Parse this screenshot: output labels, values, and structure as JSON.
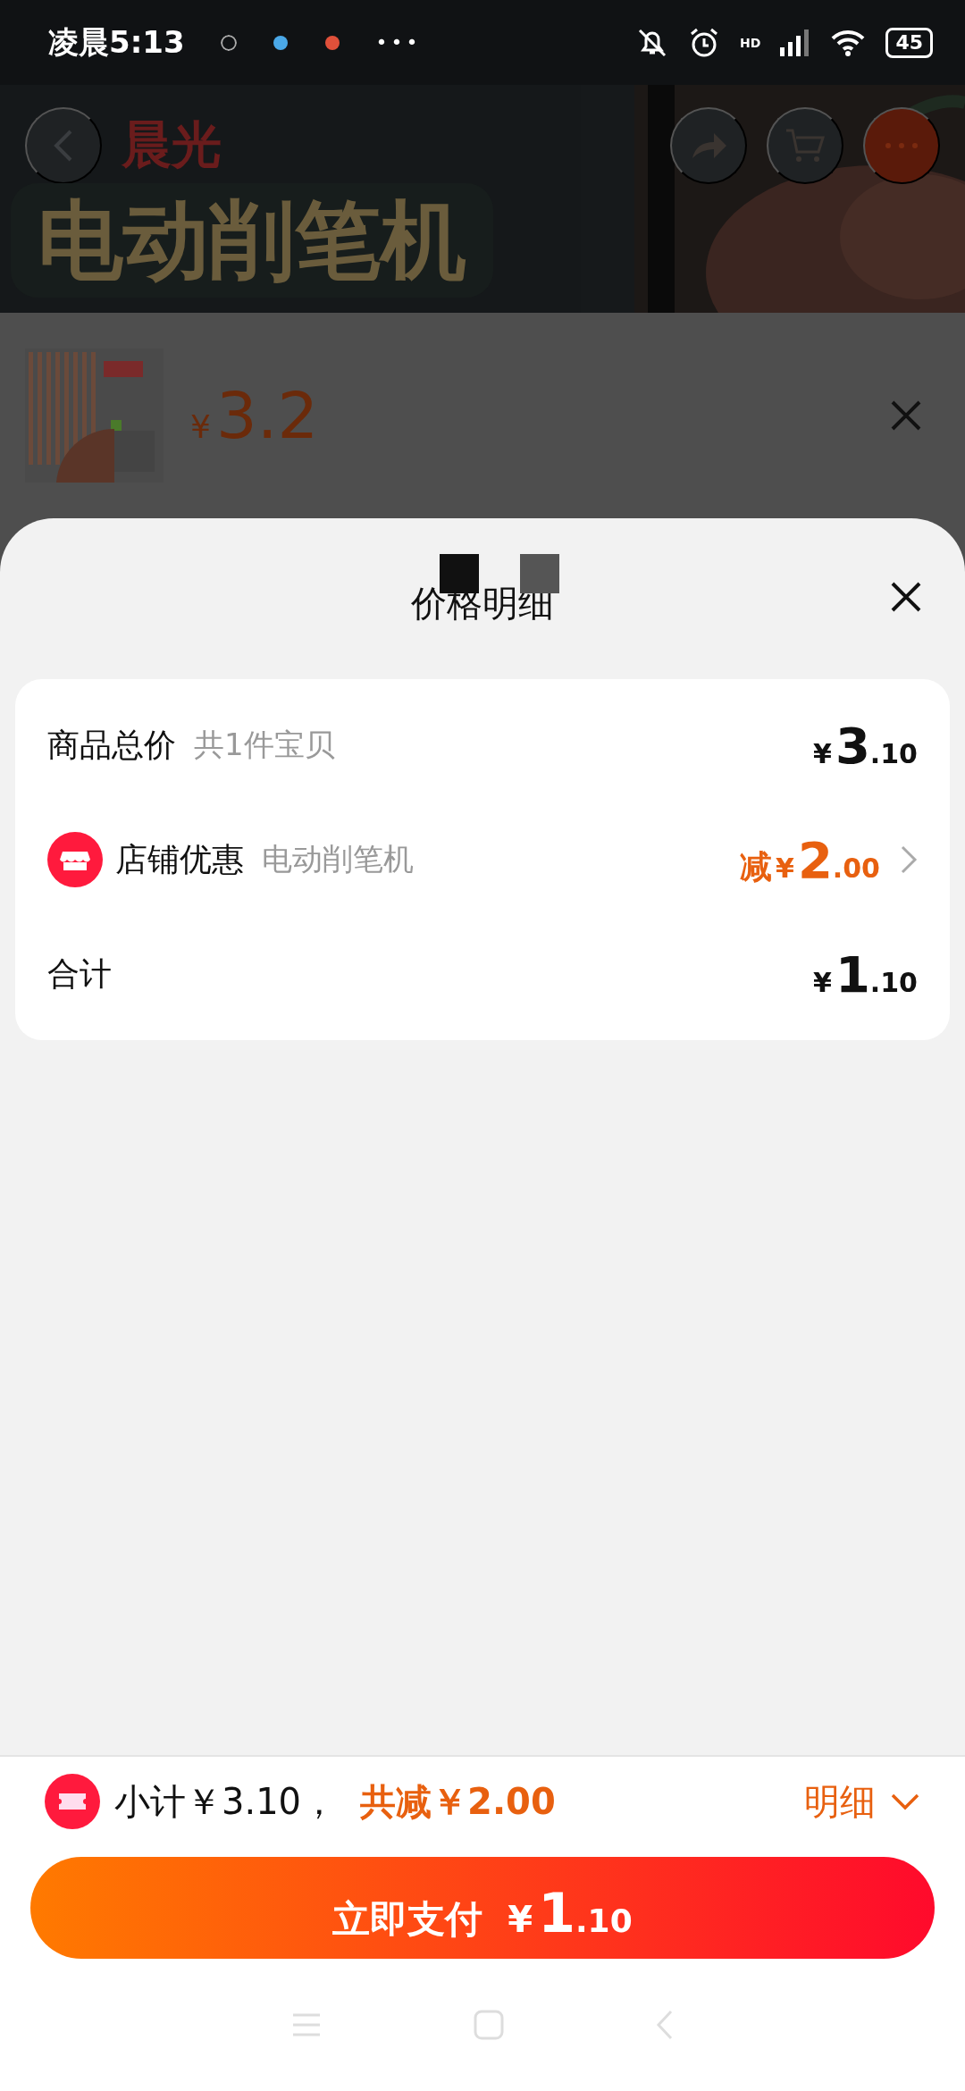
{
  "status_bar": {
    "time": "凌晨5:13",
    "more": "•••",
    "network_label": "HD",
    "battery": "45"
  },
  "header": {
    "logo": "晨光",
    "banner_title": "电动削笔机"
  },
  "product": {
    "price_symbol": "¥",
    "price": "3.2"
  },
  "sheet": {
    "title": "价格明细"
  },
  "price_rows": [
    {
      "kind": "total",
      "label": "商品总价",
      "note": "共1件宝贝",
      "symbol": "¥",
      "integer": "3",
      "decimal": ".10"
    },
    {
      "kind": "discount",
      "label": "店铺优惠",
      "note": "电动削笔机",
      "prefix": "减",
      "symbol": "¥",
      "integer": "2",
      "decimal": ".00"
    },
    {
      "kind": "sum",
      "label": "合计",
      "symbol": "¥",
      "integer": "1",
      "decimal": ".10"
    }
  ],
  "summary": {
    "subtotal": "小计￥3.10，",
    "discount": "共减￥2.00",
    "details": "明细"
  },
  "pay_button": {
    "label": "立即支付",
    "symbol": "¥",
    "integer": "1",
    "decimal": ".10"
  }
}
